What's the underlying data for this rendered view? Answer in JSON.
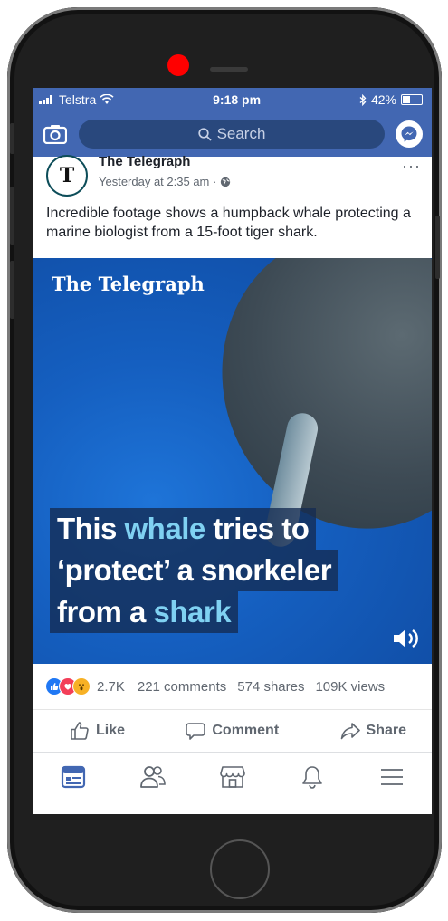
{
  "status_bar": {
    "carrier": "Telstra",
    "time": "9:18 pm",
    "battery": "42%"
  },
  "search": {
    "placeholder": "Search"
  },
  "post": {
    "page_name": "The Telegraph",
    "avatar_letter": "T",
    "timestamp": "Yesterday at 2:35 am ·",
    "more": "···",
    "text": "Incredible footage shows a humpback whale protecting a marine biologist from a 15-foot tiger shark."
  },
  "video": {
    "brand": "The Telegraph",
    "caption_line1_pre": "This ",
    "caption_line1_hl": "whale",
    "caption_line1_post": " tries to",
    "caption_line2": "‘protect’ a snorkeler",
    "caption_line3_pre": "from a ",
    "caption_line3_hl": "shark"
  },
  "engagement": {
    "reaction_count": "2.7K",
    "comments": "221 comments",
    "shares": "574 shares",
    "views": "109K views"
  },
  "actions": {
    "like": "Like",
    "comment": "Comment",
    "share": "Share"
  },
  "colors": {
    "facebook_blue": "#4267b2",
    "camera_dot": "#ff0000",
    "caption_highlight": "#7fd1f2"
  },
  "tab_icons": [
    "news-feed-icon",
    "friends-icon",
    "marketplace-icon",
    "notifications-icon",
    "menu-icon"
  ]
}
